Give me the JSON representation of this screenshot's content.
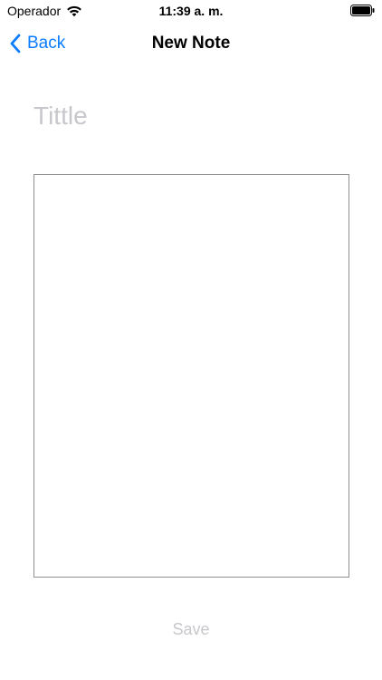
{
  "status_bar": {
    "carrier": "Operador",
    "time": "11:39 a. m.",
    "wifi_icon": "wifi-icon",
    "battery_icon": "battery-icon"
  },
  "nav": {
    "back_label": "Back",
    "title": "New Note",
    "back_icon": "chevron-left-icon",
    "accent_color": "#0a7cff"
  },
  "form": {
    "title_value": "",
    "title_placeholder": "Tittle",
    "body_value": "",
    "placeholder_color": "#c7c7cc"
  },
  "actions": {
    "save_label": "Save",
    "save_enabled": false
  }
}
